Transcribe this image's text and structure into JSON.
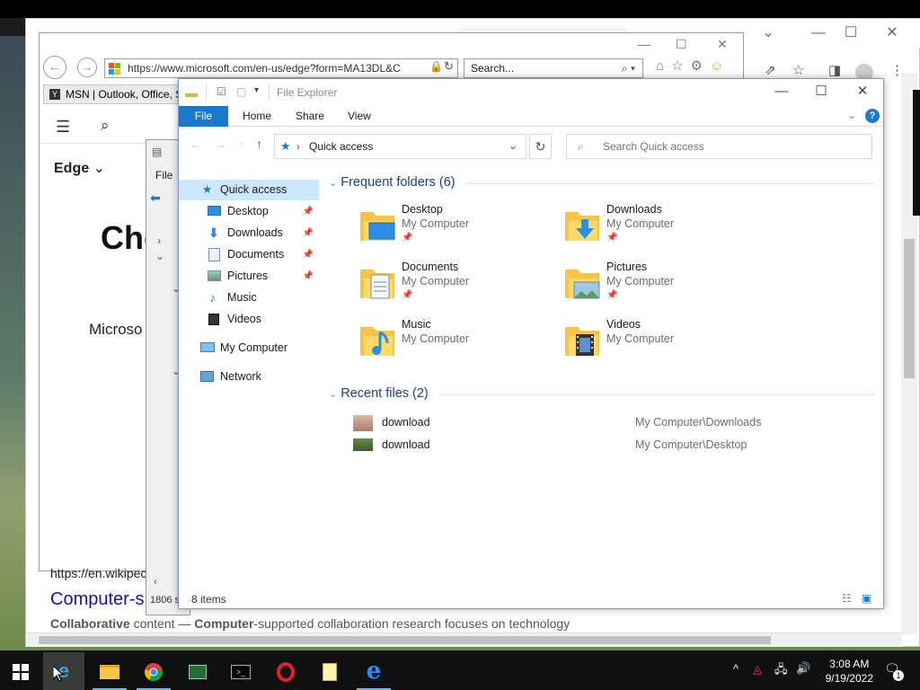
{
  "desktop": {},
  "chrome": {
    "minimize": "⌄",
    "maximize": "☐",
    "close": "✕"
  },
  "ie": {
    "url": "https://www.microsoft.com/en-us/edge?form=MA13DL&C",
    "search_placeholder": "Search...",
    "tab_title": "MSN | Outlook, Office, S",
    "nav_edge": "Edge",
    "page_heading": "Che",
    "page_text": "Microso"
  },
  "page": {
    "wiki_url": "https://en.wikipec",
    "result_title": "Computer-s",
    "snippet_bold1": "Collaborative",
    "snippet_mid": " content — ",
    "snippet_bold2": "Computer",
    "snippet_rest": "-supported collaboration research focuses on technology"
  },
  "libwin": {
    "file": "File",
    "status": "1806 s"
  },
  "explorer": {
    "title": "File Explorer",
    "ribbon_tabs": [
      "File",
      "Home",
      "Share",
      "View"
    ],
    "address": "Quick access",
    "search_placeholder": "Search Quick access",
    "nav": [
      {
        "label": "Quick access",
        "pinned": false
      },
      {
        "label": "Desktop",
        "pinned": true
      },
      {
        "label": "Downloads",
        "pinned": true
      },
      {
        "label": "Documents",
        "pinned": true
      },
      {
        "label": "Pictures",
        "pinned": true
      },
      {
        "label": "Music",
        "pinned": false
      },
      {
        "label": "Videos",
        "pinned": false
      },
      {
        "label": "My Computer",
        "pinned": false
      },
      {
        "label": "Network",
        "pinned": false
      }
    ],
    "frequent_header": "Frequent folders (6)",
    "folders": [
      {
        "name": "Desktop",
        "location": "My Computer",
        "pinned": true
      },
      {
        "name": "Downloads",
        "location": "My Computer",
        "pinned": true
      },
      {
        "name": "Documents",
        "location": "My Computer",
        "pinned": true
      },
      {
        "name": "Pictures",
        "location": "My Computer",
        "pinned": true
      },
      {
        "name": "Music",
        "location": "My Computer",
        "pinned": false
      },
      {
        "name": "Videos",
        "location": "My Computer",
        "pinned": false
      }
    ],
    "recent_header": "Recent files (2)",
    "recent": [
      {
        "name": "download",
        "path": "My Computer\\Downloads"
      },
      {
        "name": "download",
        "path": "My Computer\\Desktop"
      }
    ],
    "status": "8 items"
  },
  "taskbar": {
    "time": "3:08 AM",
    "date": "9/19/2022",
    "notification_count": "1"
  },
  "colors": {
    "accent": "#1979ca",
    "header_blue": "#1e3d8f",
    "selection": "#cce8ff",
    "folder_yellow": "#f6c548"
  }
}
